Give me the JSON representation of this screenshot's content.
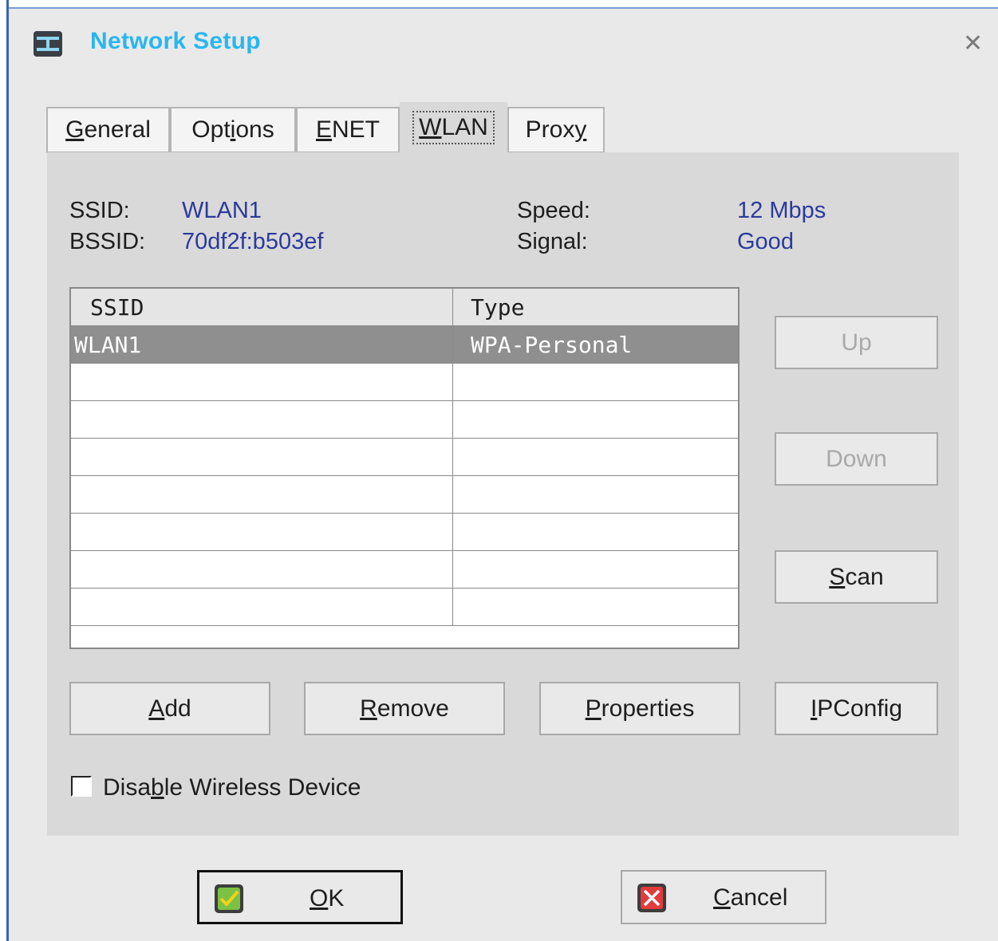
{
  "window": {
    "title": "Network Setup"
  },
  "tabs": [
    {
      "label": "General",
      "mnemonic": "G",
      "rest": "eneral"
    },
    {
      "label": "Options",
      "pre": "Opt",
      "mnemonic": "i",
      "rest": "ons"
    },
    {
      "label": "ENET",
      "mnemonic": "E",
      "rest": "NET"
    },
    {
      "label": "WLAN",
      "mnemonic": "W",
      "rest": "LAN",
      "active": true
    },
    {
      "label": "Proxy",
      "pre": "Prox",
      "mnemonic": "y",
      "rest": ""
    }
  ],
  "status": {
    "ssid_label": "SSID:",
    "ssid_value": "WLAN1",
    "bssid_label": "BSSID:",
    "bssid_value": "70df2f:b503ef",
    "speed_label": "Speed:",
    "speed_value": "12 Mbps",
    "signal_label": "Signal:",
    "signal_value": "Good"
  },
  "table": {
    "columns": [
      "SSID",
      "Type"
    ],
    "rows": [
      {
        "ssid": "WLAN1",
        "type": "WPA-Personal",
        "selected": true
      }
    ]
  },
  "side_buttons": {
    "up": "Up",
    "down": "Down",
    "scan_mnemonic": "S",
    "scan_rest": "can"
  },
  "action_buttons": {
    "add_mnemonic": "A",
    "add_rest": "dd",
    "remove_mnemonic": "R",
    "remove_rest": "emove",
    "properties_mnemonic": "P",
    "properties_rest": "roperties",
    "ipconfig_mnemonic": "I",
    "ipconfig_rest": "PConfig"
  },
  "disable_wireless": {
    "pre": "Disa",
    "mnemonic": "b",
    "rest": "le Wireless Device",
    "checked": false
  },
  "footer": {
    "ok_mnemonic": "O",
    "ok_rest": "K",
    "cancel_mnemonic": "C",
    "cancel_rest": "ancel"
  },
  "colors": {
    "title": "#29b6f0",
    "value_text": "#2b3a9c",
    "selected_row": "#8f8f8f",
    "ok_check": "#7bc143",
    "cancel_x": "#e23b3b"
  }
}
